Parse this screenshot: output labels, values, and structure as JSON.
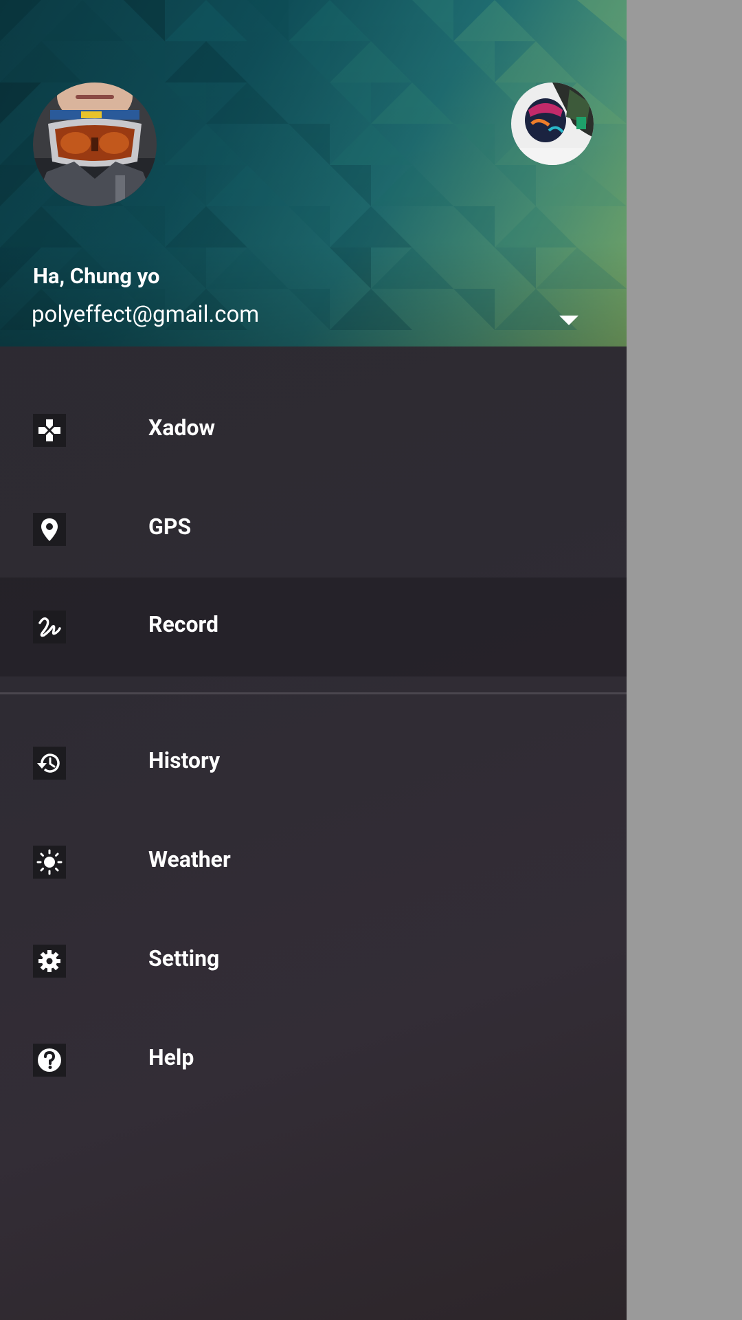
{
  "profile": {
    "name": "Ha, Chung yo",
    "email": "polyeffect@gmail.com",
    "avatar_main": "user-avatar-goggles",
    "avatar_alt": "secondary-account-avatar",
    "dropdown_icon": "triangle-down-icon"
  },
  "menu": {
    "items": [
      {
        "label": "Xadow",
        "icon": "gamepad-icon",
        "active": false
      },
      {
        "label": "GPS",
        "icon": "map-pin-icon",
        "active": false
      },
      {
        "label": "Record",
        "icon": "squiggle-icon",
        "active": true
      },
      {
        "label": "History",
        "icon": "history-icon",
        "active": false
      },
      {
        "label": "Weather",
        "icon": "sun-icon",
        "active": false
      },
      {
        "label": "Setting",
        "icon": "gear-icon",
        "active": false
      },
      {
        "label": "Help",
        "icon": "help-icon",
        "active": false
      }
    ]
  },
  "colors": {
    "drawer_bg": "#2e2b33",
    "header_start": "#0b3a43",
    "header_end": "#7fb06a",
    "scrim": "#9b9b9b",
    "text": "#ffffff"
  }
}
